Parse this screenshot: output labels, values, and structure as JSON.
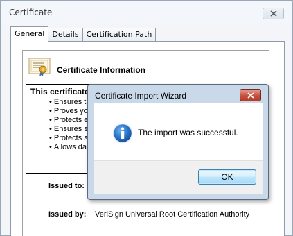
{
  "window": {
    "title": "Certificate",
    "close_icon": "close-icon"
  },
  "tabs": [
    {
      "label": "General",
      "active": true
    },
    {
      "label": "Details",
      "active": false
    },
    {
      "label": "Certification Path",
      "active": false
    }
  ],
  "certificate": {
    "icon": "certificate-icon",
    "heading": "Certificate Information",
    "intent_heading": "This certificate",
    "bullets": [
      "Ensures th",
      "Proves you",
      "Protects e",
      "Ensures so",
      "Protects s",
      "Allows dat"
    ],
    "issued_to_label": "Issued to:",
    "issued_by_label": "Issued by:",
    "issued_by_value": "VeriSign Universal Root Certification Authority"
  },
  "dialog": {
    "title": "Certificate Import Wizard",
    "message": "The import was successful.",
    "icon": "info-icon",
    "ok_label": "OK",
    "close_icon": "close-icon"
  }
}
